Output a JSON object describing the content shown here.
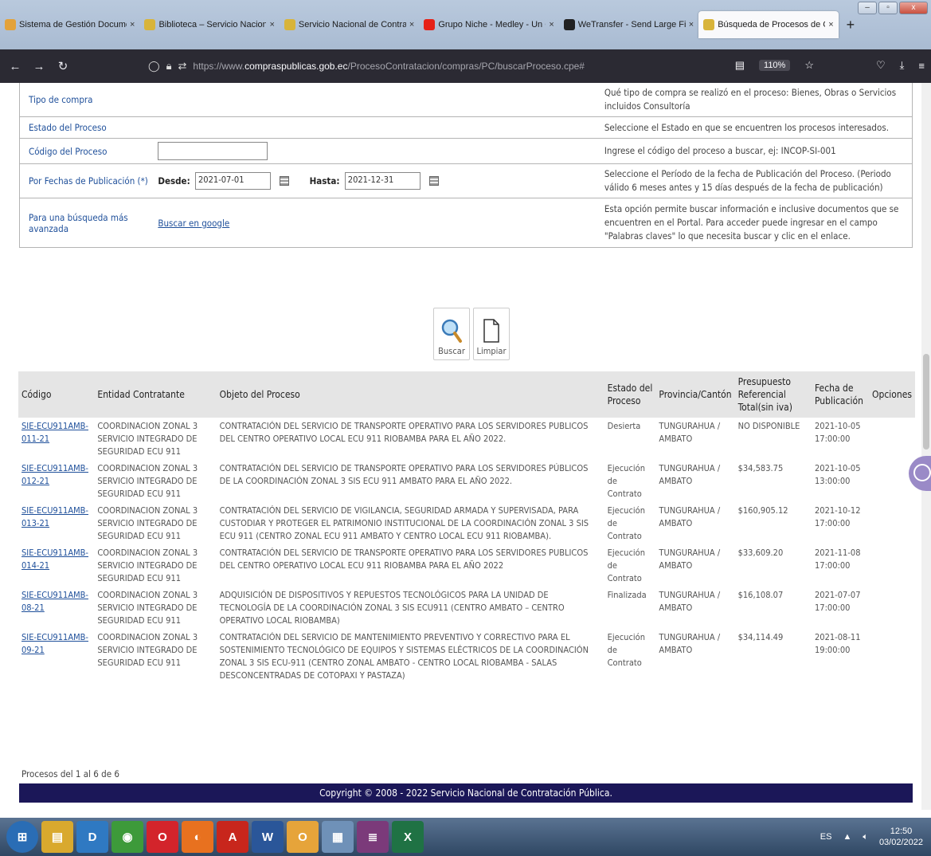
{
  "browser": {
    "tabs": [
      {
        "title": "Sistema de Gestión Documenta",
        "color": "#e3a23a",
        "active": false
      },
      {
        "title": "Biblioteca – Servicio Nacional d",
        "color": "#d8b43a",
        "active": false
      },
      {
        "title": "Servicio Nacional de Contratac",
        "color": "#d8b43a",
        "active": false
      },
      {
        "title": "Grupo Niche - Medley - Un Ca",
        "color": "#e62117",
        "active": false
      },
      {
        "title": "WeTransfer - Send Large Files &",
        "color": "#222222",
        "active": false
      },
      {
        "title": "Búsqueda de Procesos de Cont",
        "color": "#d8b43a",
        "active": true
      }
    ],
    "new_tab": "+",
    "url_dim_prefix": "https://www.",
    "url_host": "compraspublicas.gob.ec",
    "url_path": "/ProcesoContratacion/compras/PC/buscarProceso.cpe#",
    "zoom": "110%"
  },
  "search_form": {
    "rows": [
      {
        "label": "Tipo de compra",
        "help": "Qué tipo de compra se realizó en el proceso: Bienes, Obras o Servicios incluidos Consultoría"
      },
      {
        "label": "Estado del Proceso",
        "help": "Seleccione el Estado en que se encuentren los procesos interesados."
      },
      {
        "label": "Código del Proceso",
        "help": "Ingrese el código del proceso a buscar, ej: INCOP-SI-001"
      },
      {
        "label": "Por Fechas de Publicación (*)",
        "help": "Seleccione el Período de la fecha de Publicación del Proceso. (Periodo válido 6 meses antes y 15 días después de la fecha de publicación)"
      },
      {
        "label": "Para una búsqueda más avanzada",
        "help": "Esta opción permite buscar información e inclusive documentos que se encuentren en el Portal. Para acceder puede ingresar en el campo \"Palabras claves\" lo que necesita buscar y clic en el enlace."
      }
    ],
    "desde_label": "Desde:",
    "desde_value": "2021-07-01",
    "hasta_label": "Hasta:",
    "hasta_value": "2021-12-31",
    "google_link": "Buscar en google"
  },
  "buttons": {
    "buscar": "Buscar",
    "limpiar": "Limpiar"
  },
  "results": {
    "headers": [
      "Código",
      "Entidad Contratante",
      "Objeto del Proceso",
      "Estado del Proceso",
      "Provincia/Cantón",
      "Presupuesto Referencial Total(sin iva)",
      "Fecha de Publicación",
      "Opciones"
    ],
    "rows": [
      {
        "codigo": "SIE-ECU911AMB-011-21",
        "entidad": "COORDINACION ZONAL 3 SERVICIO INTEGRADO DE SEGURIDAD ECU 911",
        "objeto": "CONTRATACIÓN DEL SERVICIO DE TRANSPORTE OPERATIVO PARA LOS SERVIDORES PUBLICOS DEL CENTRO OPERATIVO LOCAL ECU 911 RIOBAMBA PARA EL AÑO 2022.",
        "estado": "Desierta",
        "provincia": "TUNGURAHUA / AMBATO",
        "presupuesto": "NO DISPONIBLE",
        "fecha": "2021-10-05 17:00:00"
      },
      {
        "codigo": "SIE-ECU911AMB-012-21",
        "entidad": "COORDINACION ZONAL 3 SERVICIO INTEGRADO DE SEGURIDAD ECU 911",
        "objeto": "CONTRATACIÓN DEL SERVICIO DE TRANSPORTE OPERATIVO PARA LOS SERVIDORES PÚBLICOS DE LA COORDINACIÓN ZONAL 3 SIS ECU 911 AMBATO PARA EL AÑO 2022.",
        "estado": "Ejecución de Contrato",
        "provincia": "TUNGURAHUA / AMBATO",
        "presupuesto": "$34,583.75",
        "fecha": "2021-10-05 13:00:00"
      },
      {
        "codigo": "SIE-ECU911AMB-013-21",
        "entidad": "COORDINACION ZONAL 3 SERVICIO INTEGRADO DE SEGURIDAD ECU 911",
        "objeto": "CONTRATACIÓN DEL SERVICIO DE VIGILANCIA, SEGURIDAD ARMADA Y SUPERVISADA, PARA CUSTODIAR Y PROTEGER EL PATRIMONIO INSTITUCIONAL DE LA COORDINACIÓN ZONAL 3 SIS ECU 911 (CENTRO ZONAL ECU 911 AMBATO Y CENTRO LOCAL ECU 911 RIOBAMBA).",
        "estado": "Ejecución de Contrato",
        "provincia": "TUNGURAHUA / AMBATO",
        "presupuesto": "$160,905.12",
        "fecha": "2021-10-12 17:00:00"
      },
      {
        "codigo": "SIE-ECU911AMB-014-21",
        "entidad": "COORDINACION ZONAL 3 SERVICIO INTEGRADO DE SEGURIDAD ECU 911",
        "objeto": "CONTRATACIÓN DEL SERVICIO DE TRANSPORTE OPERATIVO PARA LOS SERVIDORES PUBLICOS DEL CENTRO OPERATIVO LOCAL ECU 911 RIOBAMBA PARA EL AÑO 2022",
        "estado": "Ejecución de Contrato",
        "provincia": "TUNGURAHUA / AMBATO",
        "presupuesto": "$33,609.20",
        "fecha": "2021-11-08 17:00:00"
      },
      {
        "codigo": "SIE-ECU911AMB-08-21",
        "entidad": "COORDINACION ZONAL 3 SERVICIO INTEGRADO DE SEGURIDAD ECU 911",
        "objeto": "ADQUISICIÓN DE DISPOSITIVOS Y REPUESTOS TECNOLÓGICOS PARA LA UNIDAD DE TECNOLOGÍA DE LA COORDINACIÓN ZONAL 3 SIS ECU911 (CENTRO AMBATO – CENTRO OPERATIVO LOCAL RIOBAMBA)",
        "estado": "Finalizada",
        "provincia": "TUNGURAHUA / AMBATO",
        "presupuesto": "$16,108.07",
        "fecha": "2021-07-07 17:00:00"
      },
      {
        "codigo": "SIE-ECU911AMB-09-21",
        "entidad": "COORDINACION ZONAL 3 SERVICIO INTEGRADO DE SEGURIDAD ECU 911",
        "objeto": "CONTRATACIÓN DEL SERVICIO DE MANTENIMIENTO PREVENTIVO Y CORRECTIVO PARA EL SOSTENIMIENTO TECNOLÓGICO DE EQUIPOS Y SISTEMAS ELÉCTRICOS DE LA COORDINACIÓN ZONAL 3 SIS ECU-911 (CENTRO ZONAL AMBATO - CENTRO LOCAL RIOBAMBA - SALAS DESCONCENTRADAS DE COTOPAXI Y PASTAZA)",
        "estado": "Ejecución de Contrato",
        "provincia": "TUNGURAHUA / AMBATO",
        "presupuesto": "$34,114.49",
        "fecha": "2021-08-11 19:00:00"
      }
    ],
    "count_text": "Procesos del 1 al 6 de 6"
  },
  "footer": {
    "copyright": "Copyright © 2008 - 2022 Servicio Nacional de Contratación Pública."
  },
  "taskbar": {
    "icons": [
      {
        "name": "start-orb-icon",
        "color": "#2a6db5",
        "glyph": "⊞"
      },
      {
        "name": "file-explorer-icon",
        "color": "#d9a92e",
        "glyph": "▤"
      },
      {
        "name": "app-blue-icon",
        "color": "#2f79c2",
        "glyph": "D"
      },
      {
        "name": "chrome-icon",
        "color": "#3d9a3a",
        "glyph": "◉"
      },
      {
        "name": "opera-icon",
        "color": "#d3242b",
        "glyph": "O"
      },
      {
        "name": "firefox-icon",
        "color": "#e8711f",
        "glyph": "◐"
      },
      {
        "name": "acrobat-icon",
        "color": "#c8261c",
        "glyph": "A"
      },
      {
        "name": "word-icon",
        "color": "#2a5699",
        "glyph": "W"
      },
      {
        "name": "outlook-icon",
        "color": "#e6a43a",
        "glyph": "O"
      },
      {
        "name": "calculator-icon",
        "color": "#6f91b8",
        "glyph": "▦"
      },
      {
        "name": "winrar-icon",
        "color": "#7b3a7a",
        "glyph": "≣"
      },
      {
        "name": "excel-icon",
        "color": "#1f7244",
        "glyph": "X"
      }
    ],
    "language": "ES",
    "time": "12:50",
    "date": "03/02/2022"
  }
}
